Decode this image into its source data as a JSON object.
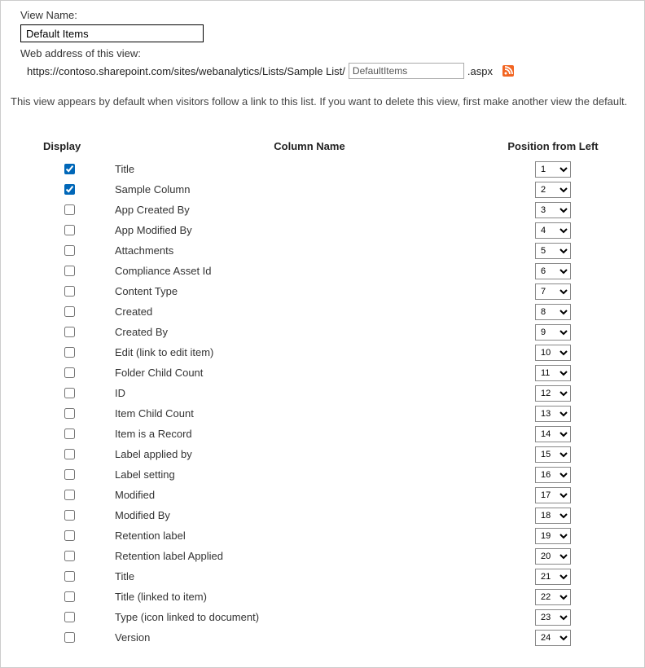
{
  "viewName": {
    "label": "View Name:",
    "value": "Default Items"
  },
  "webAddress": {
    "label": "Web address of this view:",
    "urlPrefix": "https://contoso.sharepoint.com/sites/webanalytics/Lists/Sample List/",
    "slugValue": "DefaultItems",
    "urlSuffix": ".aspx"
  },
  "infoText": "This view appears by default when visitors follow a link to this list. If you want to delete this view, first make another view the default.",
  "headers": {
    "display": "Display",
    "columnName": "Column Name",
    "position": "Position from Left"
  },
  "columns": [
    {
      "checked": true,
      "name": "Title",
      "position": 1
    },
    {
      "checked": true,
      "name": "Sample Column",
      "position": 2
    },
    {
      "checked": false,
      "name": "App Created By",
      "position": 3
    },
    {
      "checked": false,
      "name": "App Modified By",
      "position": 4
    },
    {
      "checked": false,
      "name": "Attachments",
      "position": 5
    },
    {
      "checked": false,
      "name": "Compliance Asset Id",
      "position": 6
    },
    {
      "checked": false,
      "name": "Content Type",
      "position": 7
    },
    {
      "checked": false,
      "name": "Created",
      "position": 8
    },
    {
      "checked": false,
      "name": "Created By",
      "position": 9
    },
    {
      "checked": false,
      "name": "Edit (link to edit item)",
      "position": 10
    },
    {
      "checked": false,
      "name": "Folder Child Count",
      "position": 11
    },
    {
      "checked": false,
      "name": "ID",
      "position": 12
    },
    {
      "checked": false,
      "name": "Item Child Count",
      "position": 13
    },
    {
      "checked": false,
      "name": "Item is a Record",
      "position": 14
    },
    {
      "checked": false,
      "name": "Label applied by",
      "position": 15
    },
    {
      "checked": false,
      "name": "Label setting",
      "position": 16
    },
    {
      "checked": false,
      "name": "Modified",
      "position": 17
    },
    {
      "checked": false,
      "name": "Modified By",
      "position": 18
    },
    {
      "checked": false,
      "name": "Retention label",
      "position": 19
    },
    {
      "checked": false,
      "name": "Retention label Applied",
      "position": 20
    },
    {
      "checked": false,
      "name": "Title",
      "position": 21
    },
    {
      "checked": false,
      "name": "Title (linked to item)",
      "position": 22
    },
    {
      "checked": false,
      "name": "Type (icon linked to document)",
      "position": 23
    },
    {
      "checked": false,
      "name": "Version",
      "position": 24
    }
  ]
}
